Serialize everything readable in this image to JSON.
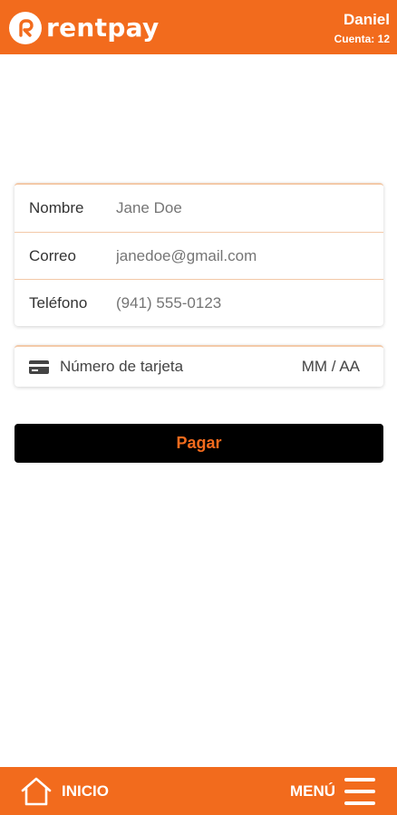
{
  "header": {
    "brand": "rentpay",
    "user_name": "Daniel",
    "account": "Cuenta: 12"
  },
  "form": {
    "name_label": "Nombre",
    "name_placeholder": "Jane Doe",
    "email_label": "Correo",
    "email_placeholder": "janedoe@gmail.com",
    "phone_label": "Teléfono",
    "phone_placeholder": "(941) 555-0123"
  },
  "card": {
    "icon": "credit-card-icon",
    "number_placeholder": "Número de tarjeta",
    "expiry_placeholder": "MM / AA"
  },
  "pay_button": "Pagar",
  "nav": {
    "home_label": "INICIO",
    "home_icon": "home-icon",
    "menu_label": "MENÚ",
    "menu_icon": "hamburger-menu-icon"
  },
  "colors": {
    "brand": "#f26b1d",
    "button": "#000000",
    "field_divider": "#f3c9a8"
  }
}
